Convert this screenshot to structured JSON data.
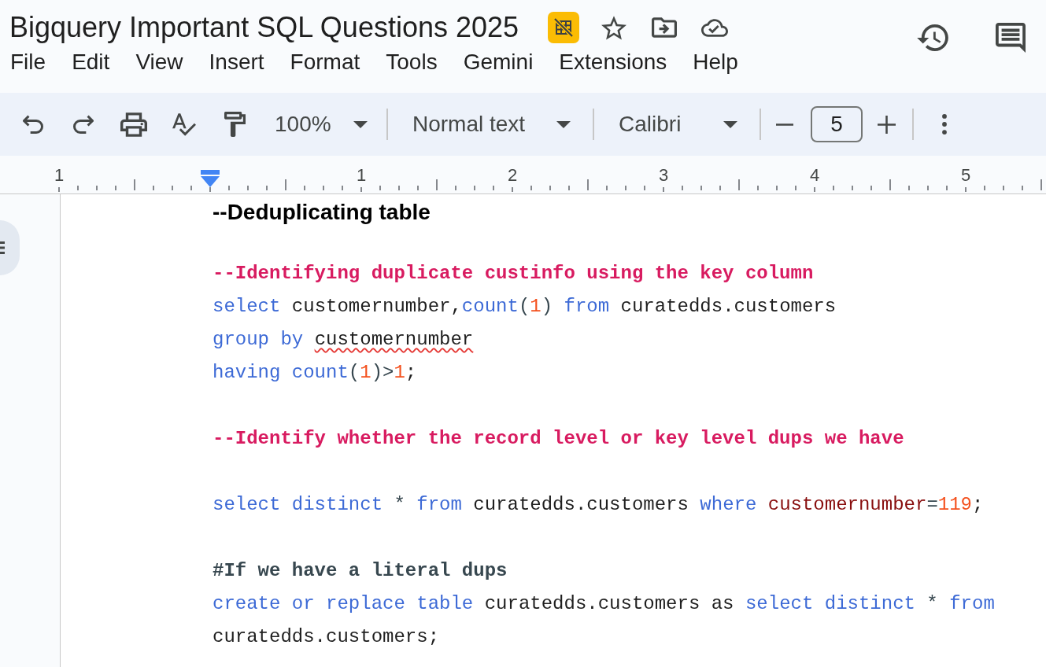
{
  "document_title": "Bigquery Important SQL Questions 2025",
  "menu": [
    "File",
    "Edit",
    "View",
    "Insert",
    "Format",
    "Tools",
    "Gemini",
    "Extensions",
    "Help"
  ],
  "toolbar": {
    "zoom": "100%",
    "paragraph_style": "Normal text",
    "font": "Calibri",
    "font_size": "5"
  },
  "ruler": {
    "labels": [
      "1",
      "1",
      "2",
      "3",
      "4",
      "5"
    ]
  },
  "document": {
    "blocks": [
      {
        "kind": "heading",
        "text": "--Deduplicating table"
      },
      {
        "kind": "blank"
      },
      {
        "kind": "code",
        "tokens": [
          {
            "kind": "comment",
            "text": "--Identifying duplicate custinfo using the key column"
          }
        ]
      },
      {
        "kind": "code",
        "tokens": [
          {
            "kind": "keyword",
            "text": "select"
          },
          {
            "kind": "plain",
            "text": " customernumber,"
          },
          {
            "kind": "keyword",
            "text": "count"
          },
          {
            "kind": "punct",
            "text": "("
          },
          {
            "kind": "number",
            "text": "1"
          },
          {
            "kind": "punct",
            "text": ") "
          },
          {
            "kind": "keyword",
            "text": "from"
          },
          {
            "kind": "plain",
            "text": " curatedds.customers"
          }
        ]
      },
      {
        "kind": "code",
        "tokens": [
          {
            "kind": "keyword",
            "text": "group by "
          },
          {
            "kind": "misspelled",
            "text": "customernumber"
          }
        ]
      },
      {
        "kind": "code",
        "tokens": [
          {
            "kind": "keyword",
            "text": "having count"
          },
          {
            "kind": "punct",
            "text": "("
          },
          {
            "kind": "number",
            "text": "1"
          },
          {
            "kind": "punct",
            "text": ")>"
          },
          {
            "kind": "number",
            "text": "1"
          },
          {
            "kind": "plain",
            "text": ";"
          }
        ]
      },
      {
        "kind": "blank"
      },
      {
        "kind": "code",
        "tokens": [
          {
            "kind": "comment",
            "text": "--Identify whether the record level or key level dups we have"
          }
        ]
      },
      {
        "kind": "blank"
      },
      {
        "kind": "code",
        "tokens": [
          {
            "kind": "keyword",
            "text": "select distinct"
          },
          {
            "kind": "punct",
            "text": " * "
          },
          {
            "kind": "keyword",
            "text": "from"
          },
          {
            "kind": "plain",
            "text": " curatedds.customers "
          },
          {
            "kind": "keyword",
            "text": "where "
          },
          {
            "kind": "column",
            "text": "customernumber"
          },
          {
            "kind": "punct",
            "text": "="
          },
          {
            "kind": "number",
            "text": "119"
          },
          {
            "kind": "plain",
            "text": ";"
          }
        ]
      },
      {
        "kind": "blank"
      },
      {
        "kind": "code",
        "tokens": [
          {
            "kind": "hash_comment",
            "text": "#If we have a literal dups"
          }
        ]
      },
      {
        "kind": "code",
        "tokens": [
          {
            "kind": "keyword",
            "text": "create or replace table"
          },
          {
            "kind": "plain",
            "text": " curatedds.customers as "
          },
          {
            "kind": "keyword",
            "text": "select distinct"
          },
          {
            "kind": "punct",
            "text": " * "
          },
          {
            "kind": "keyword",
            "text": "from"
          },
          {
            "kind": "plain",
            "text": " curatedds.customers;"
          }
        ]
      }
    ]
  }
}
